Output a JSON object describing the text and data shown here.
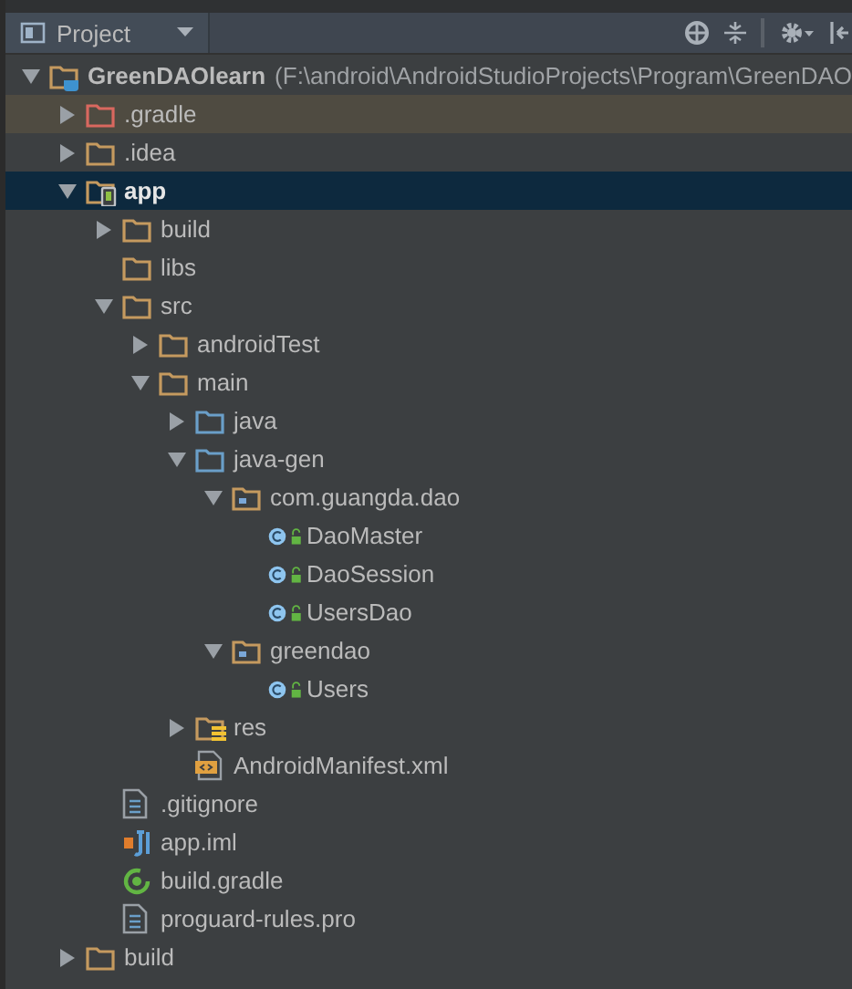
{
  "panel": {
    "title": "Project"
  },
  "tree": [
    {
      "kind": "project",
      "label": "GreenDAOlearn",
      "path": "(F:\\android\\AndroidStudioProjects\\Program\\GreenDAO",
      "expanded": true,
      "selected": false,
      "excluded": false,
      "children": [
        {
          "kind": "excluded-folder",
          "label": ".gradle",
          "expanded": false,
          "selected": false,
          "excluded": true
        },
        {
          "kind": "folder",
          "label": ".idea",
          "expanded": false,
          "selected": false,
          "excluded": false
        },
        {
          "kind": "module",
          "label": "app",
          "expanded": true,
          "selected": true,
          "excluded": false,
          "children": [
            {
              "kind": "folder",
              "label": "build",
              "expanded": false,
              "selected": false,
              "excluded": false
            },
            {
              "kind": "folder",
              "label": "libs",
              "selected": false,
              "excluded": false
            },
            {
              "kind": "folder",
              "label": "src",
              "expanded": true,
              "selected": false,
              "excluded": false,
              "children": [
                {
                  "kind": "folder",
                  "label": "androidTest",
                  "expanded": false,
                  "selected": false,
                  "excluded": false
                },
                {
                  "kind": "folder",
                  "label": "main",
                  "expanded": true,
                  "selected": false,
                  "excluded": false,
                  "children": [
                    {
                      "kind": "source-folder",
                      "label": "java",
                      "expanded": false,
                      "selected": false,
                      "excluded": false
                    },
                    {
                      "kind": "source-folder",
                      "label": "java-gen",
                      "expanded": true,
                      "selected": false,
                      "excluded": false,
                      "children": [
                        {
                          "kind": "package",
                          "label": "com.guangda.dao",
                          "expanded": true,
                          "selected": false,
                          "excluded": false,
                          "children": [
                            {
                              "kind": "class",
                              "label": "DaoMaster",
                              "selected": false,
                              "excluded": false
                            },
                            {
                              "kind": "class",
                              "label": "DaoSession",
                              "selected": false,
                              "excluded": false
                            },
                            {
                              "kind": "class",
                              "label": "UsersDao",
                              "selected": false,
                              "excluded": false
                            }
                          ]
                        },
                        {
                          "kind": "package",
                          "label": "greendao",
                          "expanded": true,
                          "selected": false,
                          "excluded": false,
                          "children": [
                            {
                              "kind": "class",
                              "label": "Users",
                              "selected": false,
                              "excluded": false
                            }
                          ]
                        }
                      ]
                    },
                    {
                      "kind": "res-folder",
                      "label": "res",
                      "expanded": false,
                      "selected": false,
                      "excluded": false
                    },
                    {
                      "kind": "manifest",
                      "label": "AndroidManifest.xml",
                      "selected": false,
                      "excluded": false
                    }
                  ]
                }
              ]
            },
            {
              "kind": "text-file",
              "label": ".gitignore",
              "selected": false,
              "excluded": false
            },
            {
              "kind": "iml",
              "label": "app.iml",
              "selected": false,
              "excluded": false
            },
            {
              "kind": "gradle",
              "label": "build.gradle",
              "selected": false,
              "excluded": false
            },
            {
              "kind": "text-file",
              "label": "proguard-rules.pro",
              "selected": false,
              "excluded": false
            }
          ]
        },
        {
          "kind": "folder",
          "label": "build",
          "expanded": false,
          "selected": false,
          "excluded": false
        }
      ]
    }
  ]
}
